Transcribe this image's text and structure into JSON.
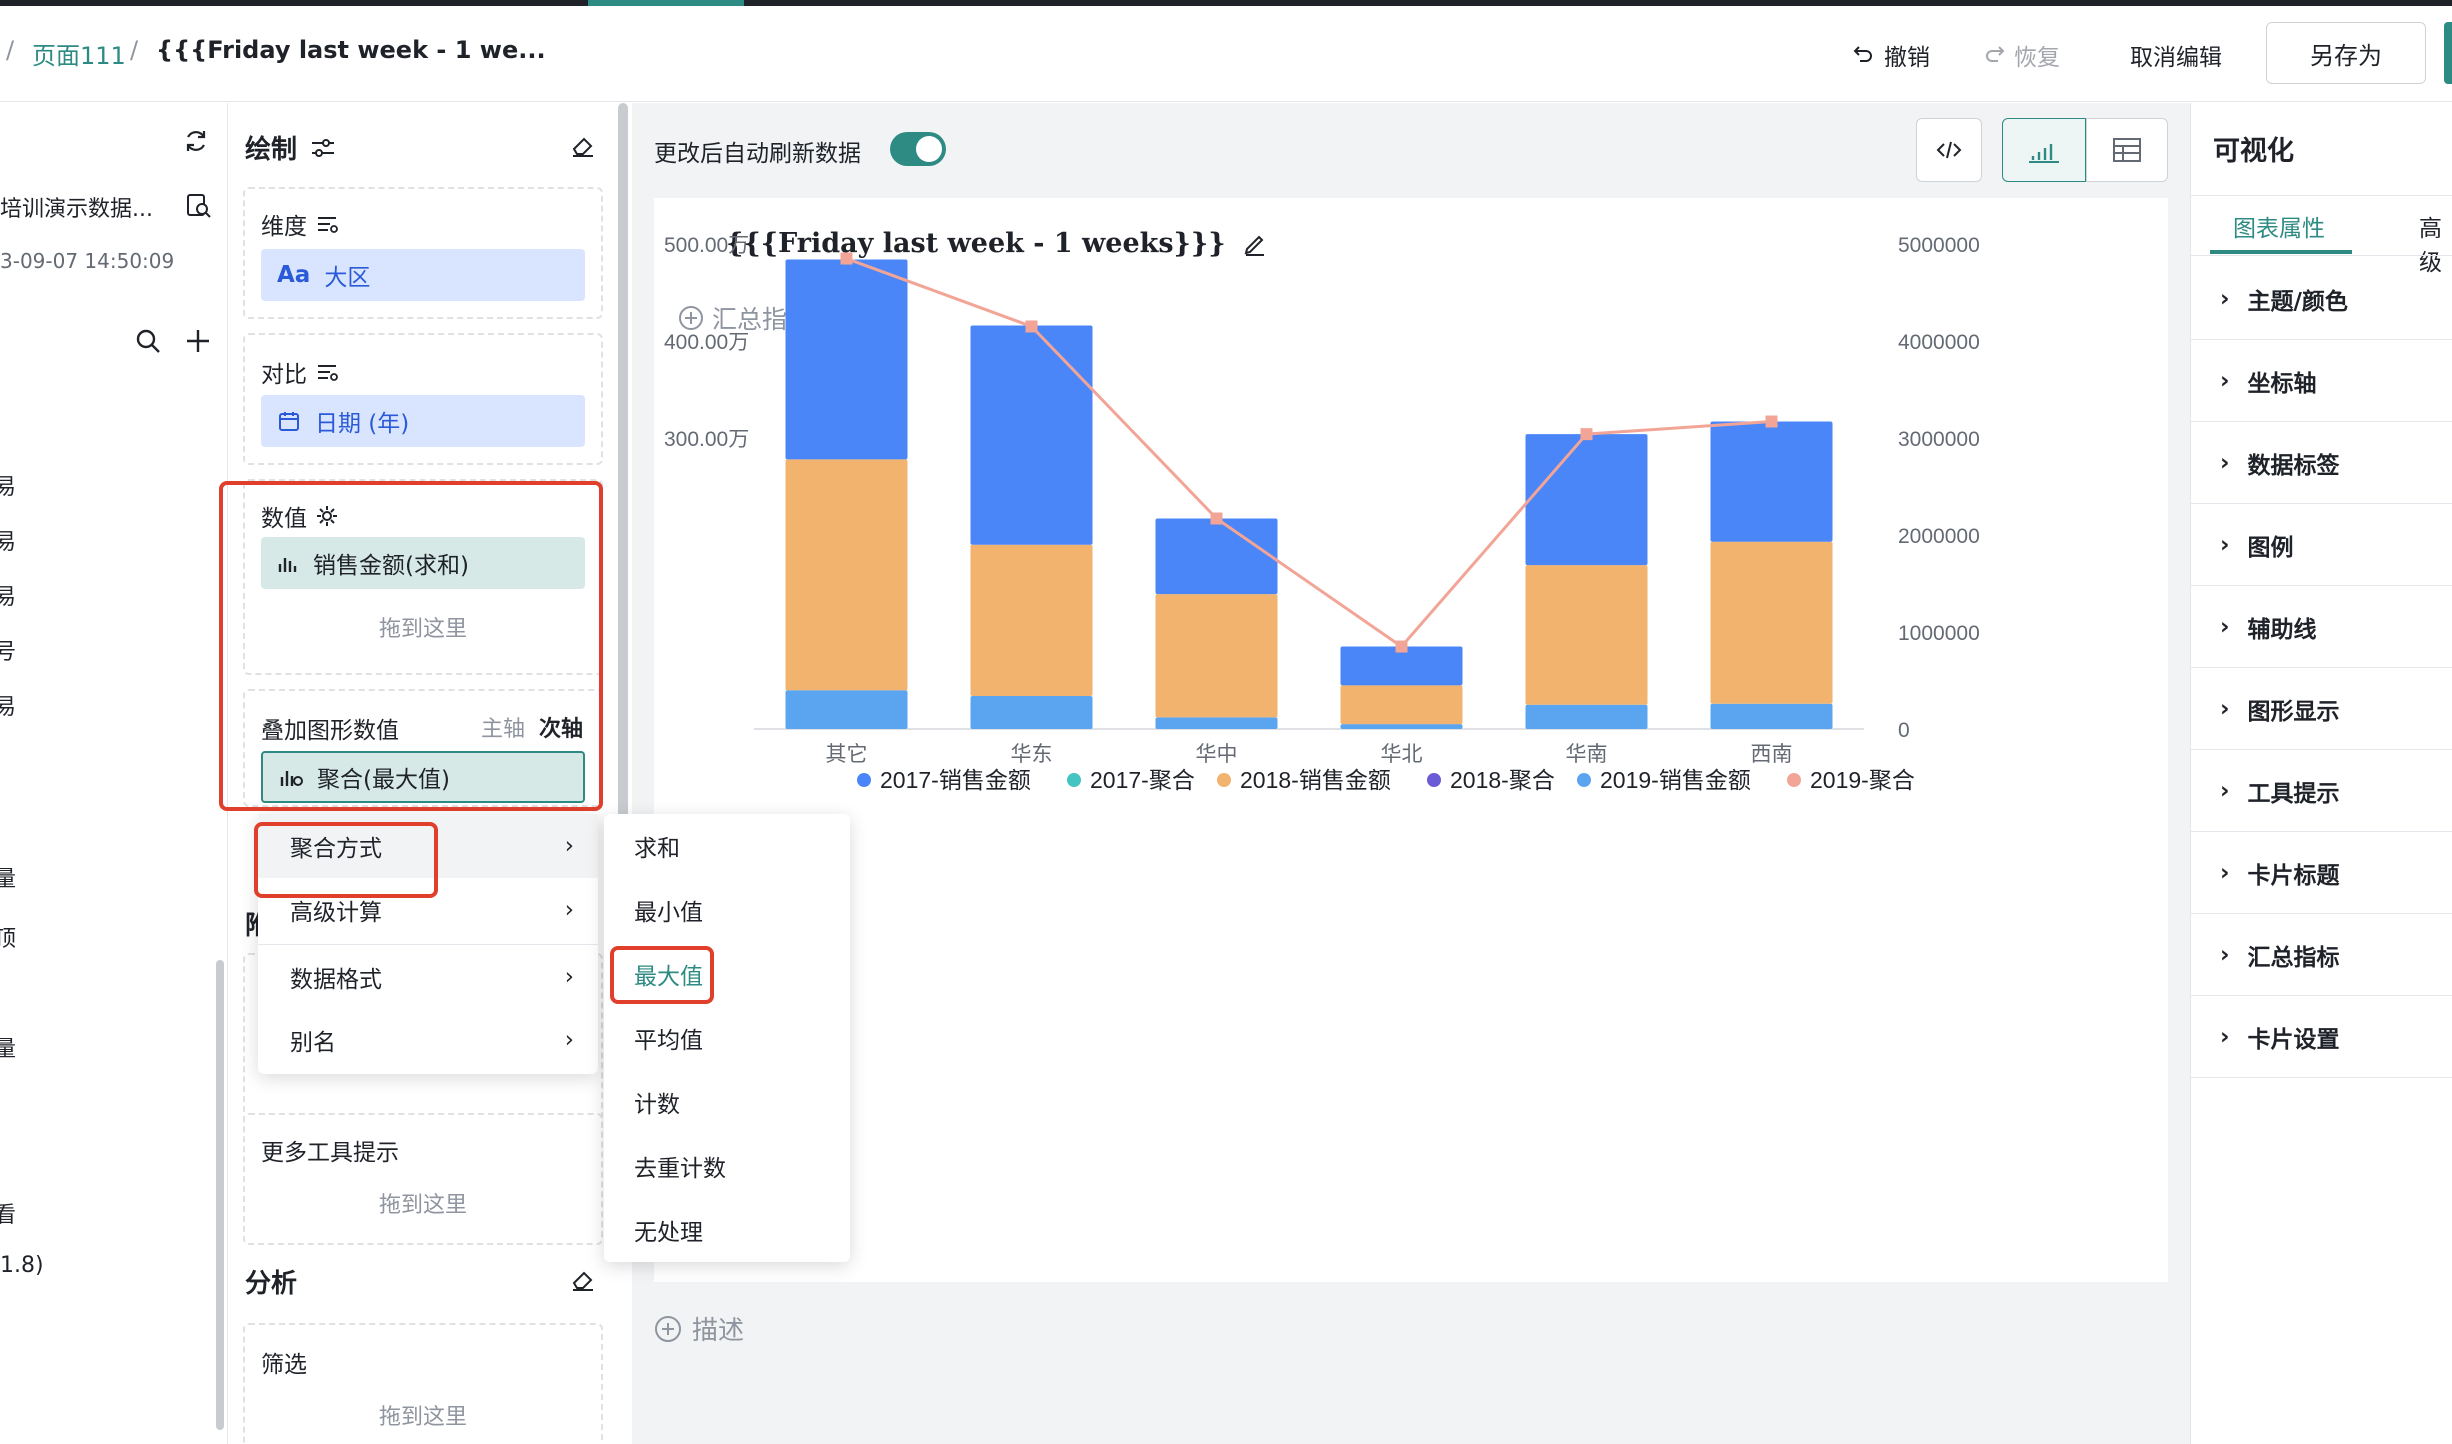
{
  "header": {
    "breadcrumb_sep1": "/",
    "breadcrumb_page": "页面111",
    "breadcrumb_sep2": "/",
    "breadcrumb_title": "{{{Friday last week - 1 we...",
    "undo": "撤销",
    "redo": "恢复",
    "cancel_edit": "取消编辑",
    "save_as": "另存为"
  },
  "left": {
    "dataset": "培训演示数据...",
    "timestamp": "3-09-07 14:50:09",
    "fragments": [
      "易",
      "易",
      "易",
      "号",
      "易",
      "量",
      "顶",
      "量",
      "看",
      "1.8)"
    ]
  },
  "draw": {
    "title": "绘制",
    "dimension_label": "维度",
    "dimension_field": "大区",
    "dimension_icon_text": "Aa",
    "compare_label": "对比",
    "compare_field": "日期 (年)",
    "value_label": "数值",
    "value_field": "销售金额(求和)",
    "drop_here": "拖到这里",
    "overlay_label": "叠加图形数值",
    "axis_primary": "主轴",
    "axis_secondary": "次轴",
    "overlay_field": "聚合(最大值)",
    "attach_partial": "附",
    "tooltip_label": "更多工具提示",
    "tooltip_drop": "拖到这里",
    "analysis_title": "分析",
    "filter_label": "筛选",
    "filter_drop": "拖到这里"
  },
  "context_menu": {
    "items": [
      "聚合方式",
      "高级计算",
      "数据格式",
      "别名"
    ]
  },
  "agg_menu": {
    "items": [
      "求和",
      "最小值",
      "最大值",
      "平均值",
      "计数",
      "去重计数",
      "无处理"
    ],
    "selected": "最大值"
  },
  "canvas": {
    "auto_refresh": "更改后自动刷新数据",
    "auto_refresh_on": true,
    "summary_metric": "汇总指标",
    "describe": "描述"
  },
  "chart_data": {
    "type": "bar",
    "title": "{{{Friday last week - 1 weeks}}}",
    "categories": [
      "其它",
      "华东",
      "华中",
      "华北",
      "华南",
      "西南"
    ],
    "stacked": true,
    "y_ticks_left": [
      "500.00万",
      "400.00万",
      "300.00万"
    ],
    "y_ticks_right": [
      "5000000",
      "4000000",
      "3000000",
      "2000000",
      "1000000",
      "0"
    ],
    "ylim_left": [
      0,
      5000000
    ],
    "ylim_right": [
      0,
      5000000
    ],
    "series": [
      {
        "name": "2017-销售金额",
        "color": "#5ba4f0",
        "values": [
          400000,
          340000,
          120000,
          50000,
          250000,
          260000
        ]
      },
      {
        "name": "2018-销售金额",
        "color": "#f2b36f",
        "values": [
          2380000,
          1560000,
          1270000,
          400000,
          1440000,
          1670000
        ]
      },
      {
        "name": "2019-销售金额",
        "color": "#4a86f7",
        "values": [
          2060000,
          2260000,
          780000,
          400000,
          1350000,
          1240000
        ]
      }
    ],
    "line_series": {
      "name": "2019-聚合",
      "color": "#f2a597",
      "values": [
        4850000,
        4150000,
        2170000,
        850000,
        3040000,
        3170000
      ]
    },
    "legend": [
      {
        "name": "2017-销售金额",
        "color": "#4a86f7"
      },
      {
        "name": "2017-聚合",
        "color": "#46c3c3"
      },
      {
        "name": "2018-销售金额",
        "color": "#f2b36f"
      },
      {
        "name": "2018-聚合",
        "color": "#6b5bd6"
      },
      {
        "name": "2019-销售金额",
        "color": "#5ba4f0"
      },
      {
        "name": "2019-聚合",
        "color": "#f2a597"
      }
    ],
    "legend_position": "bottom",
    "grid": false
  },
  "right": {
    "title": "可视化",
    "tab_active": "图表属性",
    "tab_other": "高级",
    "sections": [
      "主题/颜色",
      "坐标轴",
      "数据标签",
      "图例",
      "辅助线",
      "图形显示",
      "工具提示",
      "卡片标题",
      "汇总指标",
      "卡片设置"
    ]
  }
}
